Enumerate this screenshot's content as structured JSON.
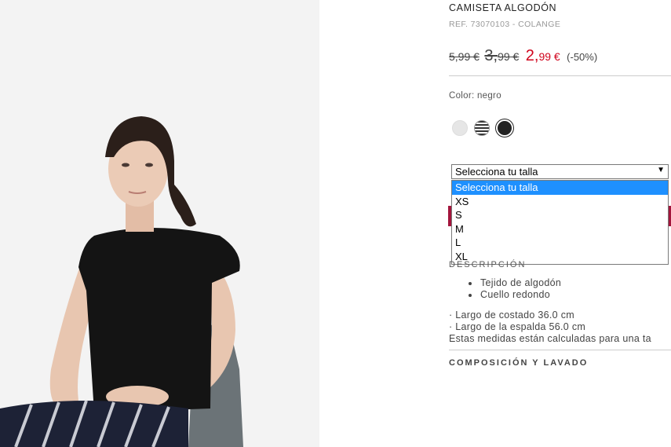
{
  "product": {
    "title": "CAMISETA ALGODÓN",
    "ref": "REF. 73070103 - COLANGE",
    "price_original": "5,99 €",
    "price_intermediate_int": "3,",
    "price_intermediate_dec": "99 €",
    "price_sale_int": "2,",
    "price_sale_dec": "99 €",
    "discount": "(-50%)"
  },
  "color": {
    "label": "Color: negro",
    "swatches": [
      {
        "name": "grey",
        "color": "#e6e6e6"
      },
      {
        "name": "striped",
        "color": "#333333"
      },
      {
        "name": "black",
        "color": "#222222",
        "selected": true
      }
    ]
  },
  "size": {
    "selected": "Selecciona tu talla",
    "options": [
      "Selecciona tu talla",
      "XS",
      "S",
      "M",
      "L",
      "XL"
    ]
  },
  "description": {
    "heading": "DESCRIPCIÓN",
    "bullets": [
      "Tejido de algodón",
      "Cuello redondo"
    ],
    "measures": [
      "· Largo de costado 36.0 cm",
      "· Largo de la espalda 56.0 cm",
      "Estas medidas están calculadas para una ta"
    ]
  },
  "composition": {
    "heading": "COMPOSICIÓN Y LAVADO"
  },
  "colors": {
    "sale": "#d0021b",
    "accent": "#a3153c",
    "highlight": "#1e90ff"
  }
}
